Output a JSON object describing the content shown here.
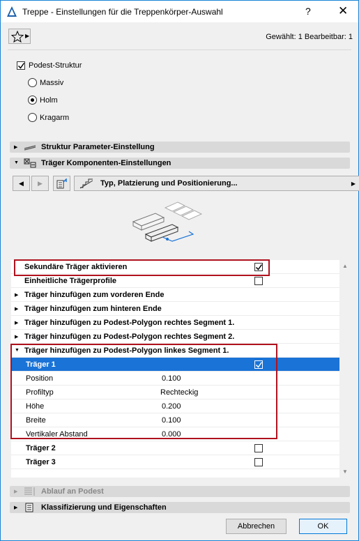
{
  "window": {
    "title": "Treppe - Einstellungen für die Treppenkörper-Auswahl",
    "help": "?",
    "close": "✕"
  },
  "status": "Gewählt: 1 Bearbeitbar: 1",
  "podest": {
    "label": "Podest-Struktur",
    "checked": true,
    "options": [
      "Massiv",
      "Holm",
      "Kragarm"
    ],
    "selected": "Holm"
  },
  "sections": {
    "struktur": "Struktur Parameter-Einstellung",
    "traeger": "Träger Komponenten-Einstellungen",
    "ablauf": "Ablauf an Podest",
    "klass": "Klassifizierung und Eigenschaften"
  },
  "nav": {
    "dropdown": "Typ, Platzierung und Positionierung..."
  },
  "list": {
    "rows": [
      {
        "label": "Sekundäre Träger aktivieren",
        "checked": true
      },
      {
        "label": "Einheitliche Trägerprofile",
        "checked": false
      },
      {
        "label": "Träger hinzufügen zum vorderen Ende"
      },
      {
        "label": "Träger hinzufügen zum hinteren Ende"
      },
      {
        "label": "Träger hinzufügen zu Podest-Polygon rechtes Segment 1."
      },
      {
        "label": "Träger hinzufügen zu Podest-Polygon rechtes Segment 2."
      },
      {
        "label": "Träger hinzufügen zu Podest-Polygon linkes Segment 1."
      },
      {
        "label": "Träger 1",
        "checked": true
      },
      {
        "label": "Position",
        "value": "0.100"
      },
      {
        "label": "Profiltyp",
        "value": "Rechteckig"
      },
      {
        "label": "Höhe",
        "value": "0.200"
      },
      {
        "label": "Breite",
        "value": "0.100"
      },
      {
        "label": "Vertikaler Abstand",
        "value": "0.000"
      },
      {
        "label": "Träger 2",
        "checked": false
      },
      {
        "label": "Träger 3",
        "checked": false
      }
    ]
  },
  "buttons": {
    "cancel": "Abbrechen",
    "ok": "OK"
  },
  "colors": {
    "selection": "#1a73d6",
    "highlight_box": "#b0111e",
    "window_border": "#1883d7"
  }
}
